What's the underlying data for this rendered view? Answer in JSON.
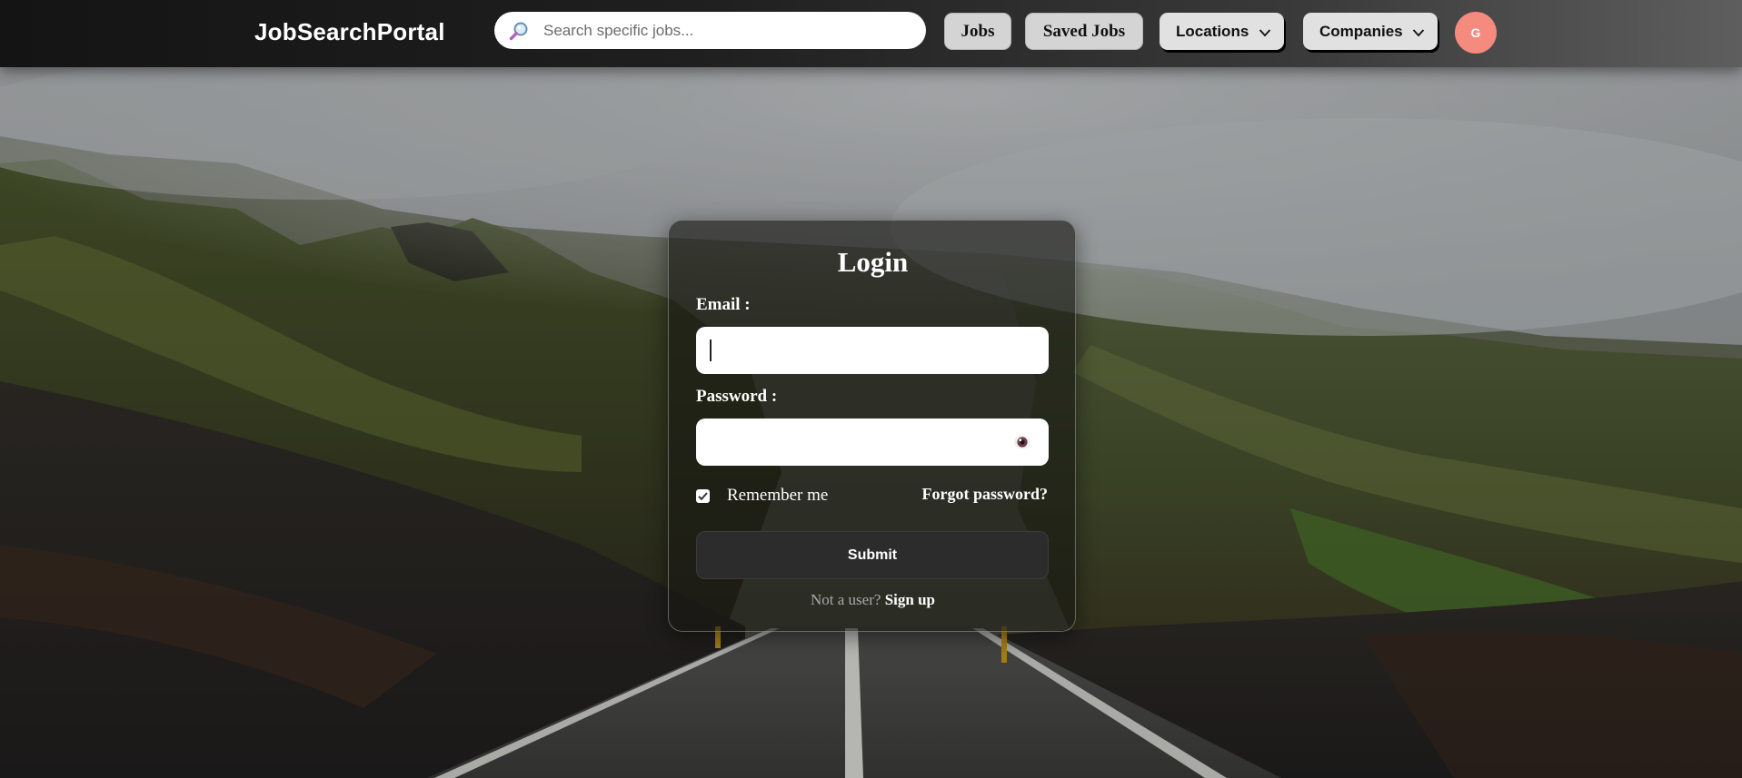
{
  "navbar": {
    "brand": "JobSearchPortal",
    "search": {
      "placeholder": "Search specific jobs...",
      "value": "",
      "icon": "magnifier-icon"
    },
    "links": {
      "jobs": "Jobs",
      "saved_jobs": "Saved Jobs"
    },
    "dropdowns": {
      "locations": "Locations",
      "companies": "Companies"
    },
    "avatar": {
      "initial": "G",
      "color": "#f58a7e"
    }
  },
  "login": {
    "title": "Login",
    "email_label": "Email :",
    "email_value": "",
    "password_label": "Password :",
    "password_value": "",
    "password_toggle_icon": "eye-icon",
    "remember_label": "Remember me",
    "remember_checked": true,
    "forgot_label": "Forgot password?",
    "submit_label": "Submit",
    "signup_prompt": "Not a user?",
    "signup_link": "Sign up"
  },
  "colors": {
    "navbar_dark": "#141414",
    "card_bg": "rgba(22,22,18,0.62)",
    "submit_bg": "#2c2c2c",
    "input_bg": "#ffffff"
  }
}
